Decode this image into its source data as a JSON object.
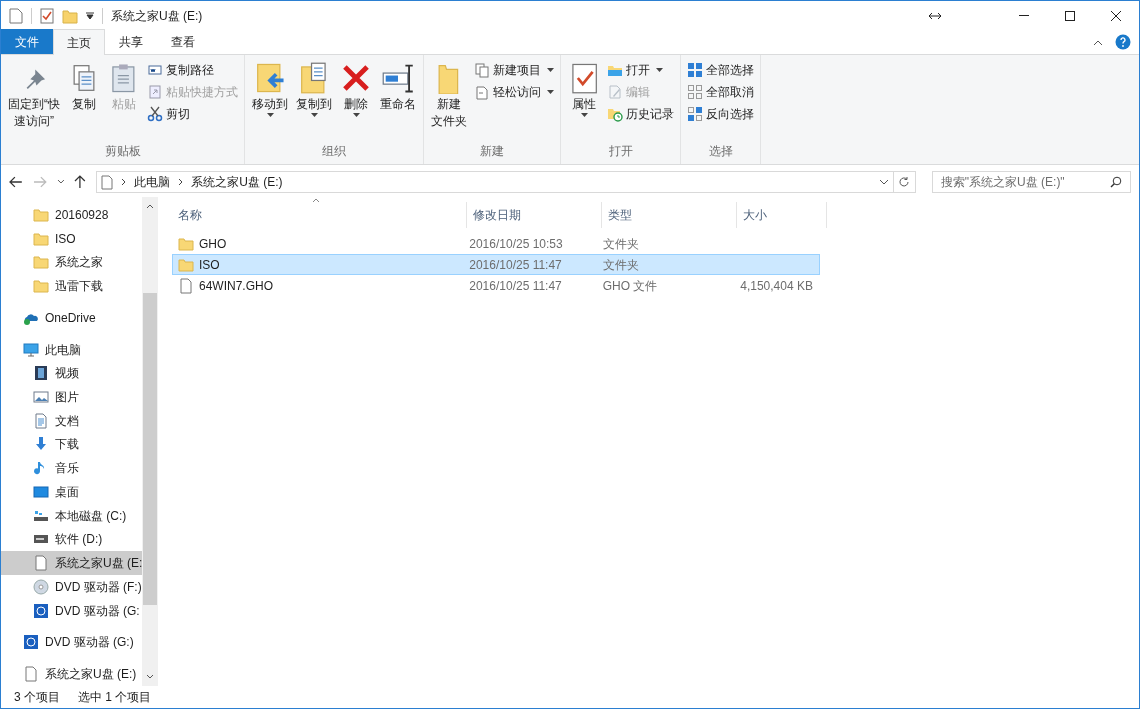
{
  "window": {
    "title": "系统之家U盘 (E:)"
  },
  "tabs": [
    {
      "label": "文件",
      "kind": "file",
      "selected": false
    },
    {
      "label": "主页",
      "kind": "tab",
      "selected": true
    },
    {
      "label": "共享",
      "kind": "tab",
      "selected": false
    },
    {
      "label": "查看",
      "kind": "tab",
      "selected": false
    }
  ],
  "ribbon": {
    "groups": [
      {
        "label": "剪贴板",
        "items": [
          {
            "kind": "large",
            "lines": [
              "固定到“快",
              "速访问”"
            ],
            "disabled": false
          },
          {
            "kind": "large",
            "lines": [
              "复制"
            ],
            "disabled": false
          },
          {
            "kind": "large",
            "lines": [
              "粘贴"
            ],
            "disabled": true
          },
          {
            "kind": "small",
            "label": "复制路径",
            "disabled": false
          },
          {
            "kind": "small",
            "label": "粘贴快捷方式",
            "disabled": true
          },
          {
            "kind": "small",
            "label": "剪切",
            "disabled": false
          }
        ]
      },
      {
        "label": "组织",
        "items": [
          {
            "kind": "large",
            "lines": [
              "移动到"
            ],
            "disabled": false,
            "dropdown": true
          },
          {
            "kind": "large",
            "lines": [
              "复制到"
            ],
            "disabled": false,
            "dropdown": true
          },
          {
            "kind": "large",
            "lines": [
              "删除"
            ],
            "disabled": false,
            "dropdown": true
          },
          {
            "kind": "large",
            "lines": [
              "重命名"
            ],
            "disabled": false
          }
        ]
      },
      {
        "label": "新建",
        "items": [
          {
            "kind": "large",
            "lines": [
              "新建",
              "文件夹"
            ],
            "disabled": false
          },
          {
            "kind": "small",
            "label": "新建项目",
            "disabled": false,
            "dropdown": true
          },
          {
            "kind": "small",
            "label": "轻松访问",
            "disabled": false,
            "dropdown": true
          }
        ]
      },
      {
        "label": "打开",
        "items": [
          {
            "kind": "large",
            "lines": [
              "属性"
            ],
            "disabled": false,
            "dropdown": true
          },
          {
            "kind": "small",
            "label": "打开",
            "disabled": false,
            "dropdown": true
          },
          {
            "kind": "small",
            "label": "编辑",
            "disabled": true
          },
          {
            "kind": "small",
            "label": "历史记录",
            "disabled": false
          }
        ]
      },
      {
        "label": "选择",
        "items": [
          {
            "kind": "small",
            "label": "全部选择",
            "disabled": false
          },
          {
            "kind": "small",
            "label": "全部取消",
            "disabled": false
          },
          {
            "kind": "small",
            "label": "反向选择",
            "disabled": false
          }
        ]
      }
    ]
  },
  "address_bar": {
    "path": [
      "此电脑",
      "系统之家U盘 (E:)"
    ],
    "search_placeholder": "搜索\"系统之家U盘 (E:)\""
  },
  "navigation": {
    "quick_access": [
      {
        "label": "20160928",
        "kind": "folder",
        "selected": false
      },
      {
        "label": "ISO",
        "kind": "folder",
        "selected": false
      },
      {
        "label": "系统之家",
        "kind": "folder",
        "selected": false
      },
      {
        "label": "迅雷下载",
        "kind": "folder",
        "selected": false
      }
    ],
    "items": [
      {
        "label": "OneDrive",
        "kind": "onedrive",
        "selected": false
      },
      {
        "label": "此电脑",
        "kind": "pc",
        "selected": false,
        "children": [
          {
            "label": "视频",
            "kind": "video",
            "selected": false
          },
          {
            "label": "图片",
            "kind": "picture",
            "selected": false
          },
          {
            "label": "文档",
            "kind": "document",
            "selected": false
          },
          {
            "label": "下载",
            "kind": "download",
            "selected": false
          },
          {
            "label": "音乐",
            "kind": "music",
            "selected": false
          },
          {
            "label": "桌面",
            "kind": "desktop",
            "selected": false
          },
          {
            "label": "本地磁盘 (C:)",
            "kind": "system-disk",
            "selected": false
          },
          {
            "label": "软件 (D:)",
            "kind": "disk",
            "selected": false
          },
          {
            "label": "系统之家U盘 (E:",
            "kind": "file",
            "selected": true
          },
          {
            "label": "DVD 驱动器 (F:)",
            "kind": "dvd",
            "selected": false
          },
          {
            "label": "DVD 驱动器 (G:",
            "kind": "dvd-blue",
            "selected": false
          }
        ]
      },
      {
        "label": "DVD 驱动器 (G:)",
        "kind": "dvd-blue",
        "selected": false
      },
      {
        "label": "系统之家U盘 (E:)",
        "kind": "file",
        "selected": false
      }
    ]
  },
  "table": {
    "columns": [
      "名称",
      "修改日期",
      "类型",
      "大小"
    ],
    "rows": [
      {
        "kind": "folder",
        "name": "GHO",
        "modified": "2016/10/25 10:53",
        "type": "文件夹",
        "size": "",
        "selected": false
      },
      {
        "kind": "folder",
        "name": "ISO",
        "modified": "2016/10/25 11:47",
        "type": "文件夹",
        "size": "",
        "selected": true
      },
      {
        "kind": "file",
        "name": "64WIN7.GHO",
        "modified": "2016/10/25 11:47",
        "type": "GHO 文件",
        "size": "4,150,404 KB",
        "selected": false
      }
    ]
  },
  "status_bar": {
    "item_count": "3 个项目",
    "selection": "选中 1 个项目"
  }
}
